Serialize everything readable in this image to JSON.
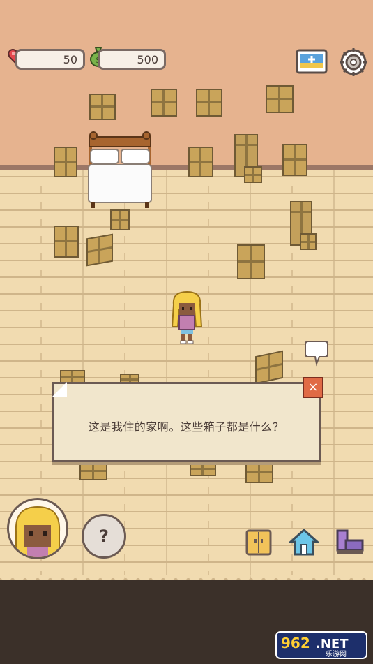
{
  "hud": {
    "hearts": "50",
    "money": "500"
  },
  "dialog": {
    "text": "这是我住的家啊。这些箱子都是什么？",
    "close_label": "×"
  },
  "controls": {
    "help_label": "?"
  },
  "icons": {
    "heart": "heart-icon",
    "money": "money-bag-icon",
    "photo": "photo-album-icon",
    "settings": "settings-icon",
    "wardrobe": "wardrobe-icon",
    "home": "home-icon",
    "furniture": "furniture-icon"
  },
  "watermark": {
    "brand": "962",
    "suffix": ".NET",
    "subtitle": "乐游网"
  },
  "colors": {
    "wall": "#e6b38f",
    "floor": "#f1dbb0",
    "box": "#c9a45a",
    "close": "#e06a45",
    "bottom_band": "#3b3029"
  }
}
